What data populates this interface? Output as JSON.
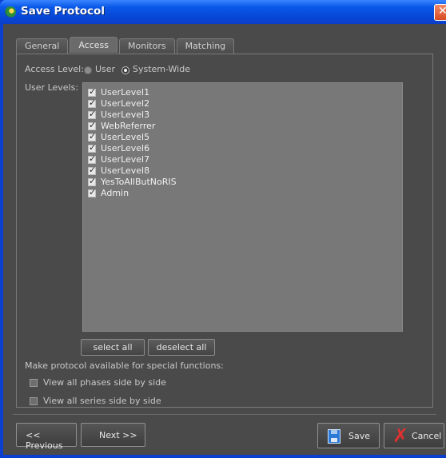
{
  "window": {
    "title": "Save Protocol"
  },
  "tabs": [
    {
      "label": "General",
      "active": false
    },
    {
      "label": "Access",
      "active": true
    },
    {
      "label": "Monitors",
      "active": false
    },
    {
      "label": "Matching",
      "active": false
    }
  ],
  "access": {
    "label": "Access Level:",
    "options": [
      {
        "label": "User",
        "selected": false
      },
      {
        "label": "System-Wide",
        "selected": true
      }
    ]
  },
  "user_levels": {
    "label": "User Levels:",
    "items": [
      {
        "label": "UserLevel1",
        "checked": true
      },
      {
        "label": "UserLevel2",
        "checked": true
      },
      {
        "label": "UserLevel3",
        "checked": true
      },
      {
        "label": "WebReferrer",
        "checked": true
      },
      {
        "label": "UserLevel5",
        "checked": true
      },
      {
        "label": "UserLevel6",
        "checked": true
      },
      {
        "label": "UserLevel7",
        "checked": true
      },
      {
        "label": "UserLevel8",
        "checked": true
      },
      {
        "label": "YesToAllButNoRIS",
        "checked": true
      },
      {
        "label": "Admin",
        "checked": true
      }
    ],
    "select_all": "select all",
    "deselect_all": "deselect all"
  },
  "special": {
    "label": "Make protocol available for special functions:",
    "options": [
      {
        "label": "View all phases side by side",
        "checked": false
      },
      {
        "label": "View all series side by side",
        "checked": false
      }
    ]
  },
  "footer": {
    "previous": "<< Previous",
    "next": "Next >>",
    "save": "Save",
    "cancel": "Cancel"
  }
}
